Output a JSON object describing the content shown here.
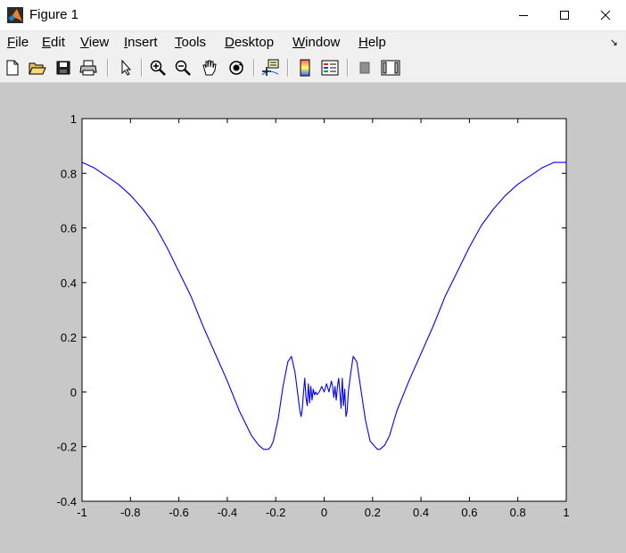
{
  "window": {
    "title": "Figure 1",
    "minimize_glyph": "—",
    "maximize_glyph": "☐",
    "close_glyph": "✕"
  },
  "menu": {
    "items": [
      {
        "label": "File",
        "accel": "F"
      },
      {
        "label": "Edit",
        "accel": "E"
      },
      {
        "label": "View",
        "accel": "V"
      },
      {
        "label": "Insert",
        "accel": "I"
      },
      {
        "label": "Tools",
        "accel": "T"
      },
      {
        "label": "Desktop",
        "accel": "D"
      },
      {
        "label": "Window",
        "accel": "W"
      },
      {
        "label": "Help",
        "accel": "H"
      }
    ],
    "overflow_glyph": "↘"
  },
  "toolbar": {
    "icons": [
      "new-figure-icon",
      "open-file-icon",
      "save-figure-icon",
      "print-figure-icon",
      "edit-plot-arrow-icon",
      "zoom-in-icon",
      "zoom-out-icon",
      "pan-hand-icon",
      "rotate-3d-icon",
      "data-cursor-icon",
      "insert-colorbar-icon",
      "insert-legend-icon",
      "hide-plot-tools-icon",
      "show-plot-tools-icon"
    ]
  },
  "colors": {
    "figure_background": "#c8c8c8",
    "axes_background": "#ffffff",
    "line": "#0000ff"
  },
  "chart_data": {
    "type": "line",
    "title": "",
    "xlabel": "",
    "ylabel": "",
    "xlim": [
      -1,
      1
    ],
    "ylim": [
      -0.4,
      1
    ],
    "xticks": [
      -1,
      -0.8,
      -0.6,
      -0.4,
      -0.2,
      0,
      0.2,
      0.4,
      0.6,
      0.8,
      1
    ],
    "xtick_labels": [
      "-1",
      "-0.8",
      "-0.6",
      "-0.4",
      "-0.2",
      "0",
      "0.2",
      "0.4",
      "0.6",
      "0.8",
      "1"
    ],
    "yticks": [
      -0.4,
      -0.2,
      0,
      0.2,
      0.4,
      0.6,
      0.8,
      1
    ],
    "ytick_labels": [
      "-0.4",
      "-0.2",
      "0",
      "0.2",
      "0.4",
      "0.6",
      "0.8",
      "1"
    ],
    "grid": false,
    "series": [
      {
        "color": "#0000ff",
        "x": [
          -1,
          -0.95,
          -0.9,
          -0.85,
          -0.8,
          -0.75,
          -0.7,
          -0.65,
          -0.6,
          -0.55,
          -0.5,
          -0.45,
          -0.4,
          -0.35,
          -0.3,
          -0.27,
          -0.25,
          -0.23,
          -0.22,
          -0.21,
          -0.19,
          -0.17,
          -0.15,
          -0.135,
          -0.12,
          -0.11,
          -0.1,
          -0.095,
          -0.09,
          -0.085,
          -0.08,
          -0.075,
          -0.07,
          -0.065,
          -0.06,
          -0.055,
          -0.05,
          -0.045,
          -0.04,
          -0.035,
          -0.03,
          -0.02,
          -0.01,
          0,
          0.01,
          0.02,
          0.03,
          0.035,
          0.04,
          0.045,
          0.05,
          0.055,
          0.06,
          0.065,
          0.07,
          0.075,
          0.08,
          0.085,
          0.09,
          0.095,
          0.1,
          0.11,
          0.12,
          0.135,
          0.15,
          0.17,
          0.19,
          0.21,
          0.22,
          0.23,
          0.25,
          0.27,
          0.3,
          0.35,
          0.4,
          0.45,
          0.5,
          0.55,
          0.6,
          0.65,
          0.7,
          0.75,
          0.8,
          0.85,
          0.9,
          0.95,
          1
        ],
        "y": [
          0.84,
          0.82,
          0.79,
          0.76,
          0.72,
          0.67,
          0.61,
          0.53,
          0.44,
          0.35,
          0.24,
          0.14,
          0.04,
          -0.07,
          -0.16,
          -0.195,
          -0.21,
          -0.21,
          -0.2,
          -0.18,
          -0.1,
          0.02,
          0.11,
          0.13,
          0.07,
          0,
          -0.07,
          -0.09,
          -0.06,
          0,
          0.05,
          -0.02,
          -0.05,
          0.03,
          -0.04,
          0.02,
          -0.03,
          0.01,
          -0.01,
          0,
          -0.01,
          0,
          0.02,
          0,
          0.03,
          0,
          0.04,
          0.02,
          -0.02,
          0.02,
          -0.03,
          0.02,
          0.05,
          0,
          -0.06,
          0.05,
          -0.05,
          0.01,
          -0.09,
          -0.07,
          0,
          0.07,
          0.13,
          0.11,
          0.02,
          -0.1,
          -0.18,
          -0.2,
          -0.21,
          -0.21,
          -0.195,
          -0.16,
          -0.07,
          0.04,
          0.14,
          0.24,
          0.35,
          0.44,
          0.53,
          0.61,
          0.67,
          0.72,
          0.76,
          0.79,
          0.82,
          0.84,
          0.84
        ]
      }
    ]
  }
}
